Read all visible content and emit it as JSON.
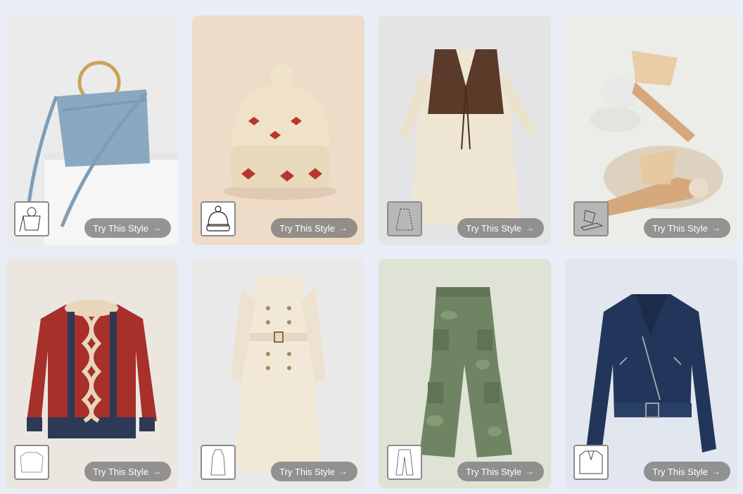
{
  "cards": [
    {
      "name": "bucket-bag",
      "bg": "#ebebeb",
      "cta": "Try This Style",
      "arrow": "→"
    },
    {
      "name": "knit-beanie",
      "bg": "#efdcc8",
      "cta": "Try This Style",
      "arrow": "→"
    },
    {
      "name": "vest-dress",
      "bg": "#e4e4e6",
      "cta": "Try This Style",
      "arrow": "→"
    },
    {
      "name": "clear-heel-sandals",
      "bg": "#ecece8",
      "cta": "Try This Style",
      "arrow": "→"
    },
    {
      "name": "cable-sweater",
      "bg": "#ebe6e0",
      "cta": "Try This Style",
      "arrow": "→"
    },
    {
      "name": "trench-coat-dress",
      "bg": "#e9e9e9",
      "cta": "Try This Style",
      "arrow": "→"
    },
    {
      "name": "camo-cargo-pants",
      "bg": "#dfe3d5",
      "cta": "Try This Style",
      "arrow": "→"
    },
    {
      "name": "denim-biker-jacket",
      "bg": "#e2e6ef",
      "cta": "Try This Style",
      "arrow": "→"
    }
  ]
}
